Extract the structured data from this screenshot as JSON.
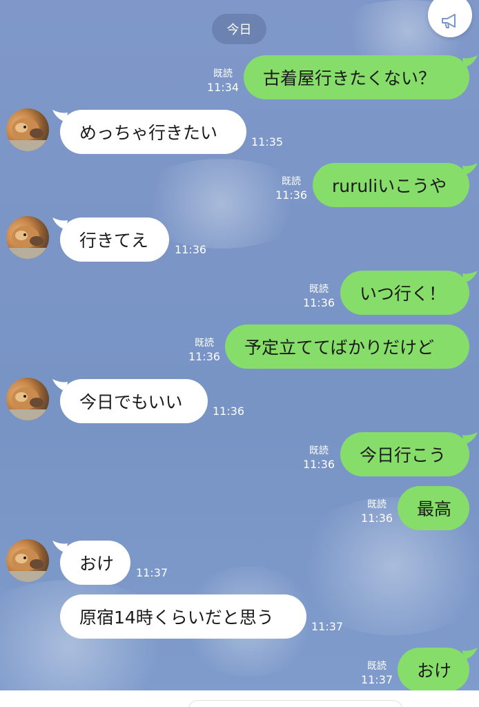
{
  "header": {
    "date_label": "今日",
    "announce_icon": "megaphone-icon"
  },
  "colors": {
    "background": "#7b95c6",
    "incoming_bubble": "#ffffff",
    "outgoing_bubble": "#86dd6a",
    "date_pill": "#6c82b0"
  },
  "messages": [
    {
      "direction": "out",
      "text": "古着屋行きたくない？",
      "read": "既読",
      "time": "11:34"
    },
    {
      "direction": "in",
      "text": "めっちゃ行きたい",
      "time": "11:35"
    },
    {
      "direction": "out",
      "text": "ruruliいこうや",
      "read": "既読",
      "time": "11:36"
    },
    {
      "direction": "in",
      "text": "行きてえ",
      "time": "11:36"
    },
    {
      "direction": "out",
      "text": "いつ行く！",
      "read": "既読",
      "time": "11:36"
    },
    {
      "direction": "out",
      "text": "予定立ててばかりだけど",
      "read": "既読",
      "time": "11:36"
    },
    {
      "direction": "in",
      "text": "今日でもいい",
      "time": "11:36"
    },
    {
      "direction": "out",
      "text": "今日行こう",
      "read": "既読",
      "time": "11:36"
    },
    {
      "direction": "out",
      "text": "最高",
      "read": "既読",
      "time": "11:36"
    },
    {
      "direction": "in",
      "text": "おけ",
      "time": "11:37"
    },
    {
      "direction": "in",
      "text": "原宿14時くらいだと思う",
      "time": "11:37"
    },
    {
      "direction": "out",
      "text": "おけ",
      "read": "既読",
      "time": "11:37"
    }
  ]
}
